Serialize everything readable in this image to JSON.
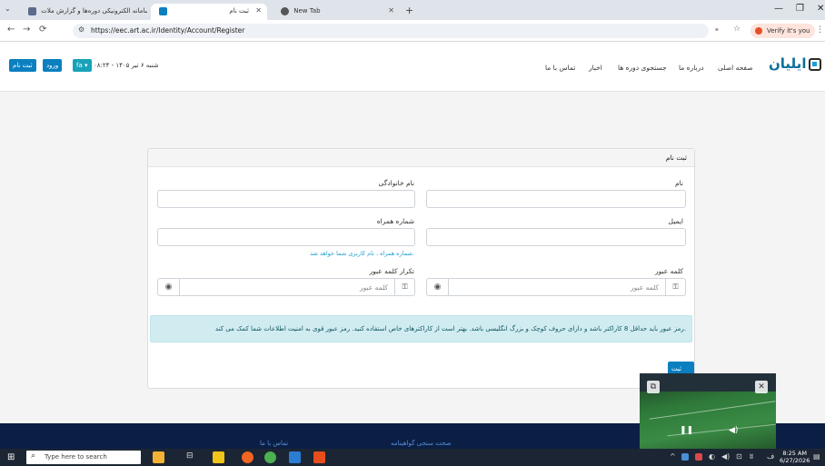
{
  "browser": {
    "tabs": [
      {
        "label": "سامانه الکترونیکی دوره‌ها و گزارش ملات...",
        "active": false
      },
      {
        "label": "ثبت نام",
        "active": true
      },
      {
        "label": "New Tab",
        "active": false
      }
    ],
    "url": "https://eec.art.ac.ir/Identity/Account/Register",
    "profile_label": "Verify it's you"
  },
  "site": {
    "logo_text": "ایلیان",
    "nav": [
      "صفحه اصلی",
      "درباره ما",
      "جستجوی دوره ها",
      "اخبار",
      "تماس با ما"
    ],
    "date_text": "شنبه ۶ تیر ۱۴۰۵ - ۰۸:۲۴",
    "lang_label": "fa ▾",
    "login_label": "ورود",
    "register_label": "ثبت نام"
  },
  "form": {
    "title": "ثبت نام",
    "first_name_label": "نام",
    "last_name_label": "نام خانوادگی",
    "email_label": "ایمیل",
    "mobile_label": "شماره همراه",
    "mobile_hint": "شماره همراه ، نام کاربری شما خواهد شد.",
    "password_label": "کلمه عبور",
    "password_placeholder": "کلمه عبور",
    "confirm_label": "تکرار کلمه عبور",
    "confirm_placeholder": "کلمه عبور",
    "info_text": "رمز عبور باید حداقل 8 کاراکتر باشد و دارای حروف کوچک و بزرگ انگلیسی باشد. بهتر است از کاراکترهای خاص استفاده کنید. رمز عبور قوی به امنیت اطلاعات شما کمک می کند.",
    "submit_label": "ثبت نام"
  },
  "footer": {
    "links": [
      "صحت سنجی گواهینامه",
      "تماس با ما"
    ]
  },
  "taskbar": {
    "search_placeholder": "Type here to search",
    "time": "8:25 AM",
    "date": "6/27/2026"
  }
}
